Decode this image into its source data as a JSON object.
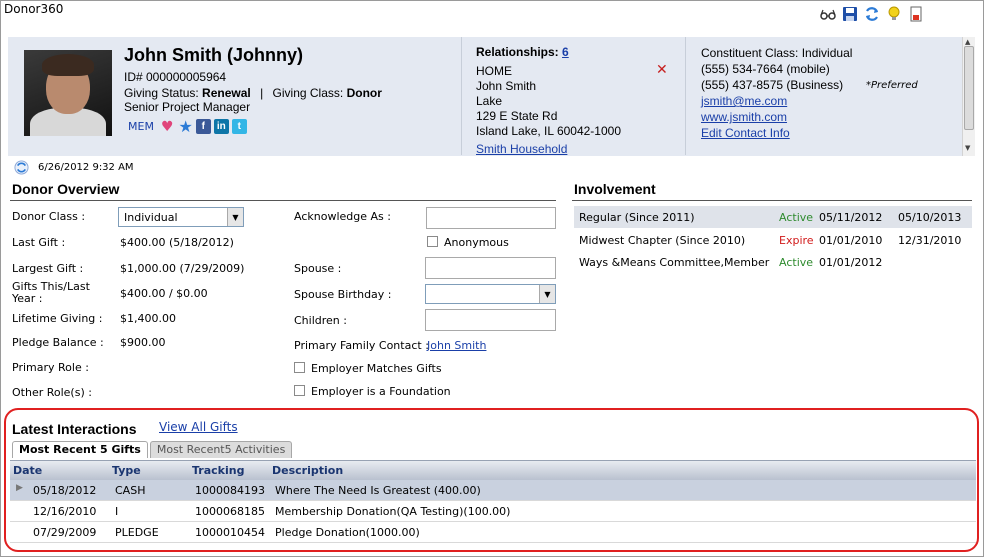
{
  "app": {
    "title": "Donor360"
  },
  "toolbar": {
    "icons": [
      "glasses-icon",
      "save-icon",
      "refresh-icon",
      "lightbulb-icon",
      "print-icon"
    ]
  },
  "header": {
    "name": "John Smith (Johnny)",
    "id_line": "ID# 000000005964",
    "giving_status_label": "Giving Status:",
    "giving_status_value": "Renewal",
    "giving_class_label": "Giving Class:",
    "giving_class_value": "Donor",
    "job_title": "Senior Project Manager",
    "mem_label": "MEM",
    "relationships_label": "Relationships:",
    "relationships_count": "6",
    "address_type": "HOME",
    "address_name": "John Smith",
    "address_line1": "Lake",
    "address_line2": "129 E State Rd",
    "address_line3": "Island Lake, IL 60042-1000",
    "household_link": "Smith Household",
    "constituent_class": "Constituent Class: Individual",
    "phone_mobile": "(555) 534-7664 (mobile)",
    "phone_business": "(555) 437-8575 (Business)",
    "preferred_label": "*Preferred",
    "email": "jsmith@me.com",
    "website": "www.jsmith.com",
    "edit_contact": "Edit Contact Info"
  },
  "timestamp": "6/26/2012 9:32 AM",
  "donor_overview": {
    "title": "Donor Overview",
    "donor_class_label": "Donor Class :",
    "donor_class_value": "Individual",
    "last_gift_label": "Last Gift :",
    "last_gift_value": "$400.00 (5/18/2012)",
    "largest_gift_label": "Largest Gift :",
    "largest_gift_value": "$1,000.00 (7/29/2009)",
    "gifts_this_last_label_1": "Gifts This/Last",
    "gifts_this_last_label_2": "Year :",
    "gifts_this_last_value": "$400.00 / $0.00",
    "lifetime_label": "Lifetime Giving :",
    "lifetime_value": "$1,400.00",
    "pledge_balance_label": "Pledge Balance :",
    "pledge_balance_value": "$900.00",
    "primary_role_label": "Primary Role :",
    "other_roles_label": "Other Role(s) :",
    "acknowledge_label": "Acknowledge As :",
    "anonymous_label": "Anonymous",
    "spouse_label": "Spouse :",
    "spouse_birthday_label": "Spouse Birthday :",
    "children_label": "Children :",
    "primary_family_label": "Primary Family Contact :",
    "primary_family_value": "John Smith",
    "employer_matches_label": "Employer Matches Gifts",
    "employer_foundation_label": "Employer is a Foundation"
  },
  "involvement": {
    "title": "Involvement",
    "rows": [
      {
        "name": "Regular (Since 2011)",
        "status": "Active",
        "start": "05/11/2012",
        "end": "05/10/2013"
      },
      {
        "name": "Midwest Chapter (Since 2010)",
        "status": "Expire",
        "start": "01/01/2010",
        "end": "12/31/2010"
      },
      {
        "name": "Ways &Means Committee,Member",
        "status": "Active",
        "start": "01/01/2012",
        "end": ""
      }
    ]
  },
  "interactions": {
    "title": "Latest Interactions",
    "view_all": "View All Gifts",
    "tab_gifts": "Most Recent 5 Gifts",
    "tab_activities": "Most Recent5 Activities",
    "columns": [
      "Date",
      "Type",
      "Tracking",
      "Description"
    ],
    "rows": [
      {
        "date": "05/18/2012",
        "type": "CASH",
        "tracking": "1000084193",
        "description": "Where The Need Is Greatest (400.00)"
      },
      {
        "date": "12/16/2010",
        "type": "I",
        "tracking": "1000068185",
        "description": "Membership Donation(QA Testing)(100.00)"
      },
      {
        "date": "07/29/2009",
        "type": "PLEDGE",
        "tracking": "1000010454",
        "description": "Pledge Donation(1000.00)"
      }
    ]
  },
  "colors": {
    "header_bg": "#e4e9f2",
    "link": "#1a3fa8",
    "active": "#2d8a2d",
    "expire": "#d11a1a",
    "highlight": "#e02020"
  }
}
